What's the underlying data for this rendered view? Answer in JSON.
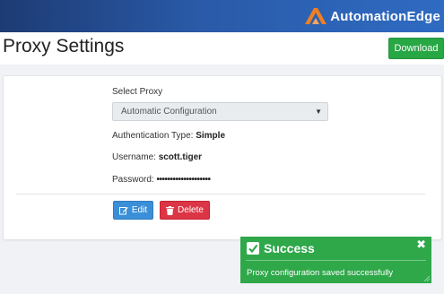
{
  "brand": {
    "name": "AutomationEdge"
  },
  "page": {
    "title": "Proxy Settings"
  },
  "toolbar": {
    "download_label": "Download"
  },
  "form": {
    "select_proxy_label": "Select Proxy",
    "select_proxy_value": "Automatic Configuration",
    "auth_type_label": "Authentication Type:",
    "auth_type_value": "Simple",
    "username_label": "Username:",
    "username_value": "scott.tiger",
    "password_label": "Password:",
    "password_value": "••••••••••••••••••••"
  },
  "actions": {
    "edit_label": "Edit",
    "delete_label": "Delete"
  },
  "toast": {
    "title": "Success",
    "message": "Proxy configuration saved successfully",
    "close_glyph": "✖"
  },
  "icons": {
    "brand": "automationedge-logo-icon",
    "select": "chevron-down-icon",
    "edit": "edit-icon",
    "delete": "trash-icon",
    "success": "checkbox-check-icon",
    "close": "close-icon"
  },
  "colors": {
    "topbar": "#1d3b73",
    "download": "#28a745",
    "edit": "#3a8fd8",
    "delete": "#dc3545",
    "toast": "#2fa84a",
    "brand_accent": "#f07f23"
  }
}
